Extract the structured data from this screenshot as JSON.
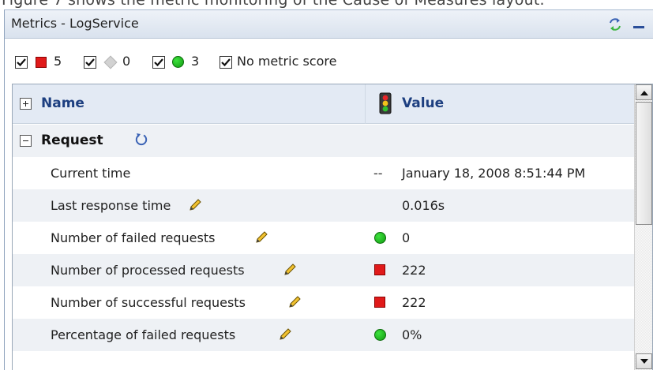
{
  "cut_text": "Figure 7 shows the metric monitoring of the Cause of Measures layout.",
  "panel": {
    "title": "Metrics - LogService"
  },
  "filters": [
    {
      "label": "5",
      "checked": true,
      "indicator": "red-square",
      "color": "#e01a1a"
    },
    {
      "label": "0",
      "checked": true,
      "indicator": "gray-diamond",
      "color": "#d2d2d2"
    },
    {
      "label": "3",
      "checked": true,
      "indicator": "green-circle",
      "color": "#22bb22"
    },
    {
      "label": "No metric score",
      "checked": true,
      "indicator": "none"
    }
  ],
  "table": {
    "col_name": "Name",
    "col_value": "Value",
    "group": {
      "label": "Request",
      "expanded": true
    },
    "rows": [
      {
        "name": "Current time",
        "status": "--",
        "value": "January 18, 2008 8:51:44 PM",
        "editable": false
      },
      {
        "name": "Last response time",
        "status": "",
        "value": "0.016s",
        "editable": true
      },
      {
        "name": "Number of failed requests",
        "status": "green-circle",
        "value": "0",
        "editable": true
      },
      {
        "name": "Number of processed requests",
        "status": "red-square",
        "value": "222",
        "editable": true
      },
      {
        "name": "Number of successful requests",
        "status": "red-square",
        "value": "222",
        "editable": true
      },
      {
        "name": "Percentage of failed requests",
        "status": "green-circle",
        "value": "0%",
        "editable": true
      }
    ]
  },
  "colors": {
    "header_text": "#1d3f80",
    "titlebar": "#d9e2ee",
    "row_alt": "#eef1f5"
  }
}
